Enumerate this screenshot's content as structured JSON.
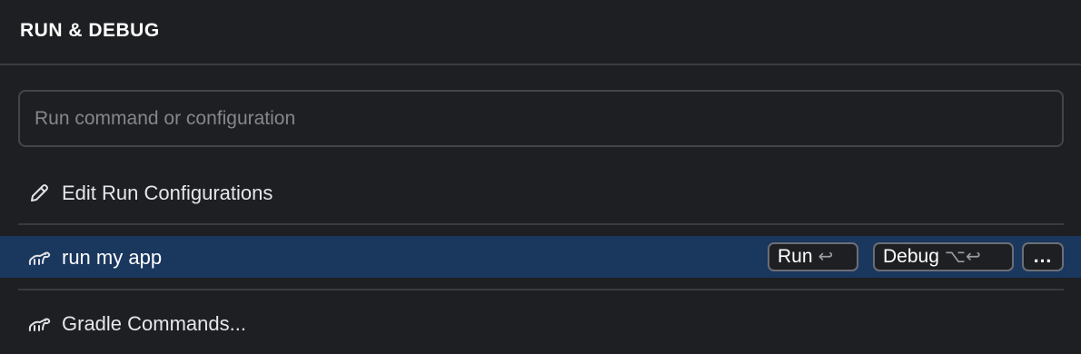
{
  "panel": {
    "title": "RUN & DEBUG"
  },
  "search": {
    "placeholder": "Run command or configuration",
    "value": ""
  },
  "items": {
    "edit": {
      "label": "Edit Run Configurations",
      "icon": "pencil-icon"
    },
    "run_config": {
      "label": "run my app",
      "icon": "gradle-elephant-icon",
      "selected": true,
      "actions": {
        "run_label": "Run",
        "run_shortcut": "↩",
        "debug_label": "Debug",
        "debug_shortcut": "⌥↩",
        "more_label": "..."
      }
    },
    "gradle": {
      "label": "Gradle Commands...",
      "icon": "gradle-elephant-icon"
    }
  },
  "colors": {
    "background": "#1e1f22",
    "selection": "#1a375e",
    "separator": "#393b40",
    "text": "#dfe1e5",
    "placeholder": "#85878c"
  }
}
